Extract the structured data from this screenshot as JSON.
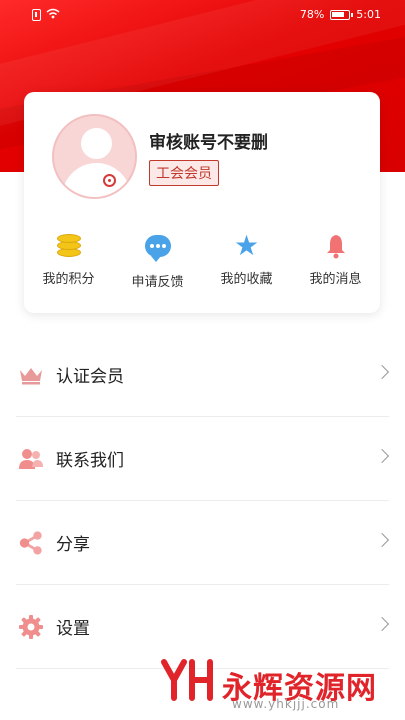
{
  "status_bar": {
    "battery": "78%",
    "time": "5:01"
  },
  "profile": {
    "username": "审核账号不要删",
    "member_tag": "工会会员"
  },
  "quick_actions": [
    {
      "label": "我的积分",
      "icon": "coins-icon"
    },
    {
      "label": "申请反馈",
      "icon": "chat-bubble-icon"
    },
    {
      "label": "我的收藏",
      "icon": "star-icon"
    },
    {
      "label": "我的消息",
      "icon": "bell-icon"
    }
  ],
  "menu": [
    {
      "label": "认证会员",
      "icon": "crown-icon"
    },
    {
      "label": "联系我们",
      "icon": "contacts-icon"
    },
    {
      "label": "分享",
      "icon": "share-icon"
    },
    {
      "label": "设置",
      "icon": "gear-icon"
    }
  ],
  "watermark": {
    "text": "永辉资源网",
    "url": "www.yhkjjj.com"
  },
  "colors": {
    "primary_red": "#e30000",
    "accent_blue": "#4aa3e8",
    "gold": "#f3c518",
    "icon_pink": "#f07272"
  }
}
